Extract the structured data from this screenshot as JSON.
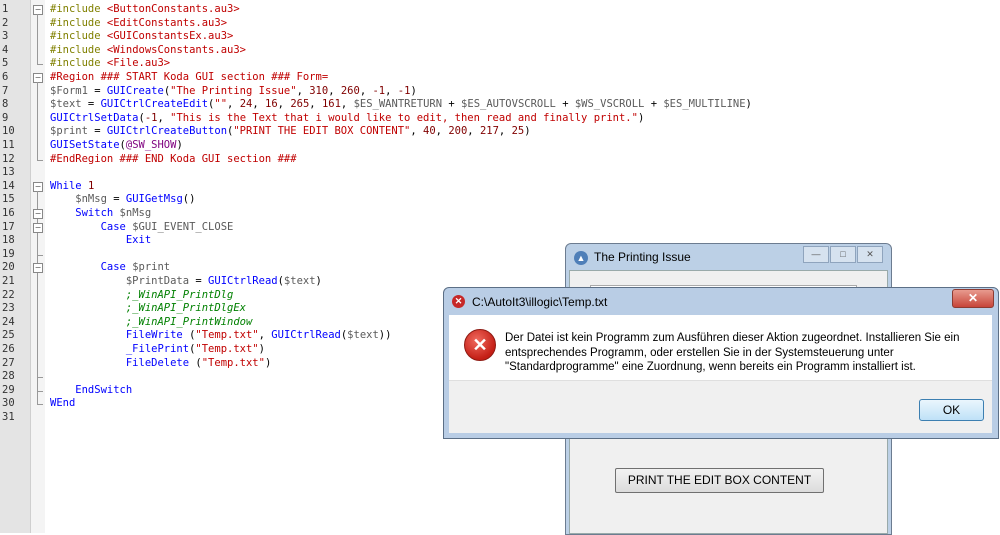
{
  "editor": {
    "line_numbers": [
      "1",
      "2",
      "3",
      "4",
      "5",
      "6",
      "7",
      "8",
      "9",
      "10",
      "11",
      "12",
      "13",
      "14",
      "15",
      "16",
      "17",
      "18",
      "19",
      "20",
      "21",
      "22",
      "23",
      "24",
      "25",
      "26",
      "27",
      "28",
      "29",
      "30",
      "31"
    ],
    "lines": [
      [
        {
          "t": "#include ",
          "c": "inc"
        },
        {
          "t": "<ButtonConstants.au3>",
          "c": "str"
        }
      ],
      [
        {
          "t": "#include ",
          "c": "inc"
        },
        {
          "t": "<EditConstants.au3>",
          "c": "str"
        }
      ],
      [
        {
          "t": "#include ",
          "c": "inc"
        },
        {
          "t": "<GUIConstantsEx.au3>",
          "c": "str"
        }
      ],
      [
        {
          "t": "#include ",
          "c": "inc"
        },
        {
          "t": "<WindowsConstants.au3>",
          "c": "str"
        }
      ],
      [
        {
          "t": "#include ",
          "c": "inc"
        },
        {
          "t": "<File.au3>",
          "c": "str"
        }
      ],
      [
        {
          "t": "#Region ### START Koda GUI section ### Form=",
          "c": "reg"
        }
      ],
      [
        {
          "t": "$Form1",
          "c": "var"
        },
        {
          "t": " = ",
          "c": ""
        },
        {
          "t": "GUICreate",
          "c": "func"
        },
        {
          "t": "(",
          "c": ""
        },
        {
          "t": "\"The Printing Issue\"",
          "c": "str"
        },
        {
          "t": ", ",
          "c": ""
        },
        {
          "t": "310",
          "c": "num"
        },
        {
          "t": ", ",
          "c": ""
        },
        {
          "t": "260",
          "c": "num"
        },
        {
          "t": ", ",
          "c": ""
        },
        {
          "t": "-1",
          "c": "num"
        },
        {
          "t": ", ",
          "c": ""
        },
        {
          "t": "-1",
          "c": "num"
        },
        {
          "t": ")",
          "c": ""
        }
      ],
      [
        {
          "t": "$text",
          "c": "var"
        },
        {
          "t": " = ",
          "c": ""
        },
        {
          "t": "GUICtrlCreateEdit",
          "c": "func"
        },
        {
          "t": "(",
          "c": ""
        },
        {
          "t": "\"\"",
          "c": "str"
        },
        {
          "t": ", ",
          "c": ""
        },
        {
          "t": "24",
          "c": "num"
        },
        {
          "t": ", ",
          "c": ""
        },
        {
          "t": "16",
          "c": "num"
        },
        {
          "t": ", ",
          "c": ""
        },
        {
          "t": "265",
          "c": "num"
        },
        {
          "t": ", ",
          "c": ""
        },
        {
          "t": "161",
          "c": "num"
        },
        {
          "t": ", ",
          "c": ""
        },
        {
          "t": "$ES_WANTRETURN",
          "c": "var"
        },
        {
          "t": " + ",
          "c": ""
        },
        {
          "t": "$ES_AUTOVSCROLL",
          "c": "var"
        },
        {
          "t": " + ",
          "c": ""
        },
        {
          "t": "$WS_VSCROLL",
          "c": "var"
        },
        {
          "t": " + ",
          "c": ""
        },
        {
          "t": "$ES_MULTILINE",
          "c": "var"
        },
        {
          "t": ")",
          "c": ""
        }
      ],
      [
        {
          "t": "GUICtrlSetData",
          "c": "func"
        },
        {
          "t": "(",
          "c": ""
        },
        {
          "t": "-1",
          "c": "num"
        },
        {
          "t": ", ",
          "c": ""
        },
        {
          "t": "\"This is the Text that i would like to edit, then read and finally print.\"",
          "c": "str"
        },
        {
          "t": ")",
          "c": ""
        }
      ],
      [
        {
          "t": "$print",
          "c": "var"
        },
        {
          "t": " = ",
          "c": ""
        },
        {
          "t": "GUICtrlCreateButton",
          "c": "func"
        },
        {
          "t": "(",
          "c": ""
        },
        {
          "t": "\"PRINT THE EDIT BOX CONTENT\"",
          "c": "str"
        },
        {
          "t": ", ",
          "c": ""
        },
        {
          "t": "40",
          "c": "num"
        },
        {
          "t": ", ",
          "c": ""
        },
        {
          "t": "200",
          "c": "num"
        },
        {
          "t": ", ",
          "c": ""
        },
        {
          "t": "217",
          "c": "num"
        },
        {
          "t": ", ",
          "c": ""
        },
        {
          "t": "25",
          "c": "num"
        },
        {
          "t": ")",
          "c": ""
        }
      ],
      [
        {
          "t": "GUISetState",
          "c": "func"
        },
        {
          "t": "(",
          "c": ""
        },
        {
          "t": "@SW_SHOW",
          "c": "mac"
        },
        {
          "t": ")",
          "c": ""
        }
      ],
      [
        {
          "t": "#EndRegion ### END Koda GUI section ###",
          "c": "reg"
        }
      ],
      [],
      [
        {
          "t": "While ",
          "c": "kw"
        },
        {
          "t": "1",
          "c": "num"
        }
      ],
      [
        {
          "t": "    $nMsg",
          "c": "var"
        },
        {
          "t": " = ",
          "c": ""
        },
        {
          "t": "GUIGetMsg",
          "c": "func"
        },
        {
          "t": "()",
          "c": ""
        }
      ],
      [
        {
          "t": "    Switch ",
          "c": "kw"
        },
        {
          "t": "$nMsg",
          "c": "var"
        }
      ],
      [
        {
          "t": "        Case ",
          "c": "kw"
        },
        {
          "t": "$GUI_EVENT_CLOSE",
          "c": "var"
        }
      ],
      [
        {
          "t": "            Exit",
          "c": "kw"
        }
      ],
      [],
      [
        {
          "t": "        Case ",
          "c": "kw"
        },
        {
          "t": "$print",
          "c": "var"
        }
      ],
      [
        {
          "t": "            $PrintData",
          "c": "var"
        },
        {
          "t": " = ",
          "c": ""
        },
        {
          "t": "GUICtrlRead",
          "c": "func"
        },
        {
          "t": "(",
          "c": ""
        },
        {
          "t": "$text",
          "c": "var"
        },
        {
          "t": ")",
          "c": ""
        }
      ],
      [
        {
          "t": "            ;_WinAPI_PrintDlg",
          "c": "com"
        }
      ],
      [
        {
          "t": "            ;_WinAPI_PrintDlgEx",
          "c": "com"
        }
      ],
      [
        {
          "t": "            ;_WinAPI_PrintWindow",
          "c": "com"
        }
      ],
      [
        {
          "t": "            FileWrite",
          "c": "func"
        },
        {
          "t": " (",
          "c": ""
        },
        {
          "t": "\"Temp.txt\"",
          "c": "str"
        },
        {
          "t": ", ",
          "c": ""
        },
        {
          "t": "GUICtrlRead",
          "c": "func"
        },
        {
          "t": "(",
          "c": ""
        },
        {
          "t": "$text",
          "c": "var"
        },
        {
          "t": "))",
          "c": ""
        }
      ],
      [
        {
          "t": "            _FilePrint",
          "c": "func"
        },
        {
          "t": "(",
          "c": ""
        },
        {
          "t": "\"Temp.txt\"",
          "c": "str"
        },
        {
          "t": ")",
          "c": ""
        }
      ],
      [
        {
          "t": "            FileDelete",
          "c": "func"
        },
        {
          "t": " (",
          "c": ""
        },
        {
          "t": "\"Temp.txt\"",
          "c": "str"
        },
        {
          "t": ")",
          "c": ""
        }
      ],
      [],
      [
        {
          "t": "    EndSwitch",
          "c": "kw"
        }
      ],
      [
        {
          "t": "WEnd",
          "c": "kw"
        }
      ],
      []
    ]
  },
  "gui_window": {
    "title": "The Printing Issue",
    "button_label": "PRINT THE EDIT BOX CONTENT",
    "control_icons": [
      "minimize-icon",
      "maximize-icon",
      "close-icon"
    ]
  },
  "error_dialog": {
    "title": "C:\\AutoIt3\\illogic\\Temp.txt",
    "message": "Der Datei ist kein Programm zum Ausführen dieser Aktion zugeordnet. Installieren Sie ein entsprechendes Programm, oder erstellen Sie in der Systemsteuerung unter \"Standardprogramme\" eine Zuordnung, wenn bereits ein Programm installiert ist.",
    "ok_label": "OK",
    "close_glyph": "✕",
    "icon": "error-icon"
  },
  "colors": {
    "string": "#c00000",
    "keyword": "#0000ff",
    "comment": "#008000",
    "variable": "#5a5a5a",
    "titlebar": "#b9cde5"
  }
}
